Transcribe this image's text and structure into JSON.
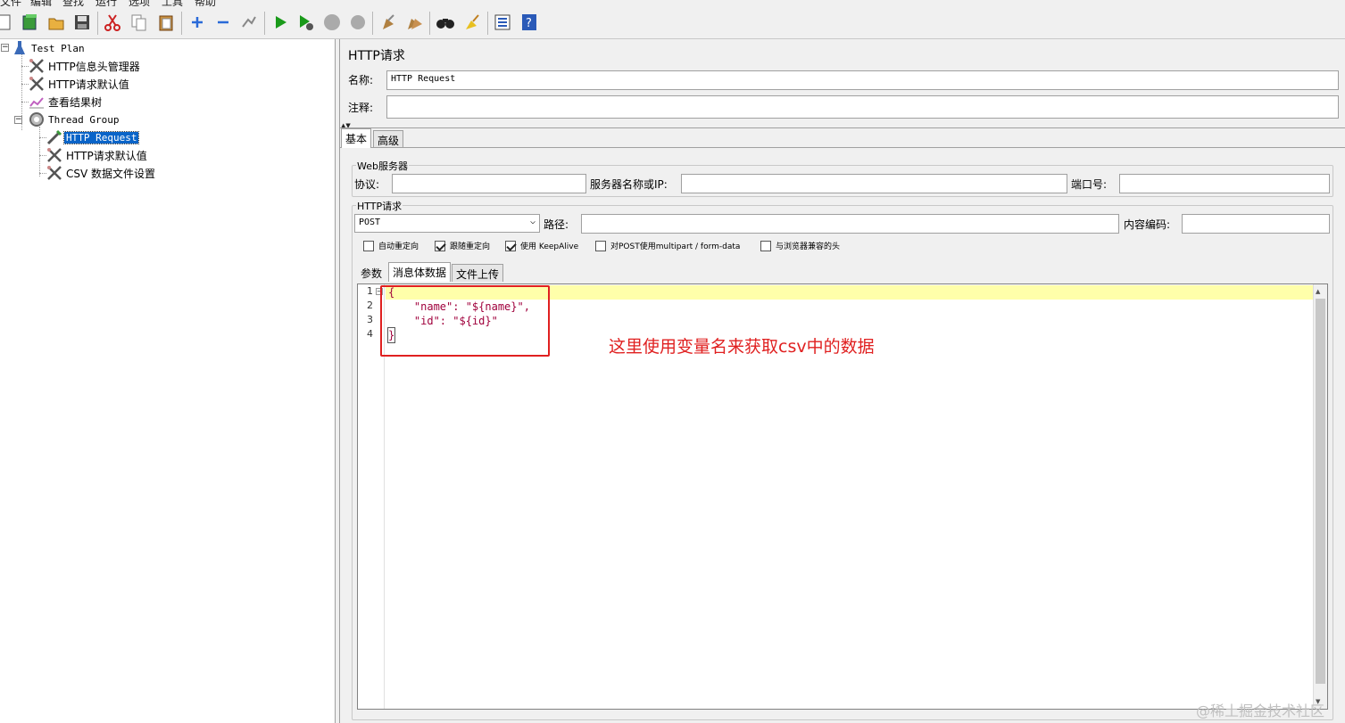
{
  "menu": {
    "items": [
      "文件",
      "编辑",
      "查找",
      "运行",
      "选项",
      "工具",
      "帮助"
    ]
  },
  "toolbar": {
    "buttons": [
      "new-icon",
      "templates-icon",
      "open-icon",
      "save-icon",
      "cut-icon",
      "copy-icon",
      "paste-icon",
      "expand-icon",
      "collapse-icon",
      "toggle-icon",
      "start-icon",
      "start-no-pause-icon",
      "stop-icon",
      "shutdown-icon",
      "clear-icon",
      "clear-all-icon",
      "search-icon",
      "reset-search-icon",
      "function-helper-icon",
      "help-icon"
    ]
  },
  "tree": {
    "items": [
      {
        "label": "Test Plan",
        "icon": "test-plan-icon"
      },
      {
        "label": "HTTP信息头管理器",
        "icon": "wrench-icon"
      },
      {
        "label": "HTTP请求默认值",
        "icon": "wrench-icon"
      },
      {
        "label": "查看结果树",
        "icon": "listener-icon"
      },
      {
        "label": "Thread Group",
        "icon": "thread-group-icon"
      },
      {
        "label": "HTTP Request",
        "icon": "sampler-icon",
        "selected": true
      },
      {
        "label": "HTTP请求默认值",
        "icon": "wrench-icon"
      },
      {
        "label": "CSV 数据文件设置",
        "icon": "wrench-icon"
      }
    ]
  },
  "panel": {
    "title": "HTTP请求",
    "name_label": "名称:",
    "name_value": "HTTP Request",
    "comment_label": "注释:",
    "comment_value": "",
    "tabs": [
      "基本",
      "高级"
    ],
    "active_tab": "基本"
  },
  "web_server": {
    "legend": "Web服务器",
    "protocol_label": "协议:",
    "protocol_value": "",
    "server_label": "服务器名称或IP:",
    "server_value": "",
    "port_label": "端口号:",
    "port_value": ""
  },
  "http_request": {
    "legend": "HTTP请求",
    "method": "POST",
    "path_label": "路径:",
    "path_value": "",
    "encoding_label": "内容编码:",
    "encoding_value": "",
    "options": [
      {
        "label": "自动重定向",
        "checked": false
      },
      {
        "label": "跟随重定向",
        "checked": true
      },
      {
        "label": "使用 KeepAlive",
        "checked": true
      },
      {
        "label": "对POST使用multipart / form-data",
        "checked": false
      },
      {
        "label": "与浏览器兼容的头",
        "checked": false
      }
    ],
    "subtabs": [
      "参数",
      "消息体数据",
      "文件上传"
    ],
    "active_subtab": "消息体数据"
  },
  "body": {
    "line_numbers": [
      "1",
      "2",
      "3",
      "4"
    ],
    "lines": [
      "{",
      "    \"name\": \"${name}\",",
      "    \"id\": \"${id}\"",
      "}"
    ]
  },
  "annotation": {
    "text": "这里使用变量名来获取csv中的数据",
    "color": "#e02020"
  },
  "watermark": "@稀土掘金技术社区"
}
